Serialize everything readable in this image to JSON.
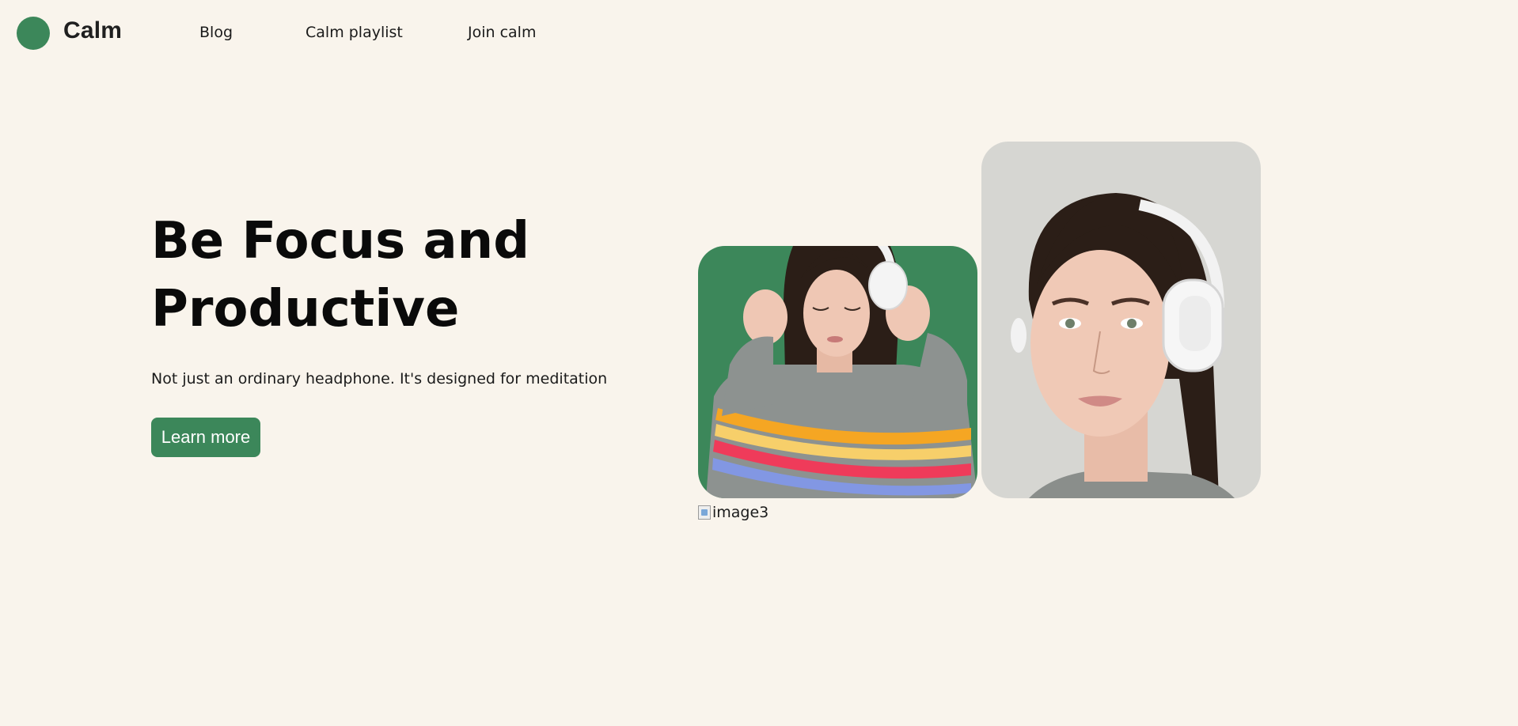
{
  "colors": {
    "accent": "#3c875a",
    "background": "#f9f4ec"
  },
  "nav": {
    "brand": "Calm",
    "links": [
      {
        "label": "Blog"
      },
      {
        "label": "Calm playlist"
      },
      {
        "label": "Join calm"
      }
    ]
  },
  "hero": {
    "title_line1": "Be Focus and",
    "title_line2": "Productive",
    "subtitle": "Not just an ordinary headphone. It's designed for meditation",
    "cta_label": "Learn more"
  },
  "images": {
    "broken_alt": "image3"
  }
}
